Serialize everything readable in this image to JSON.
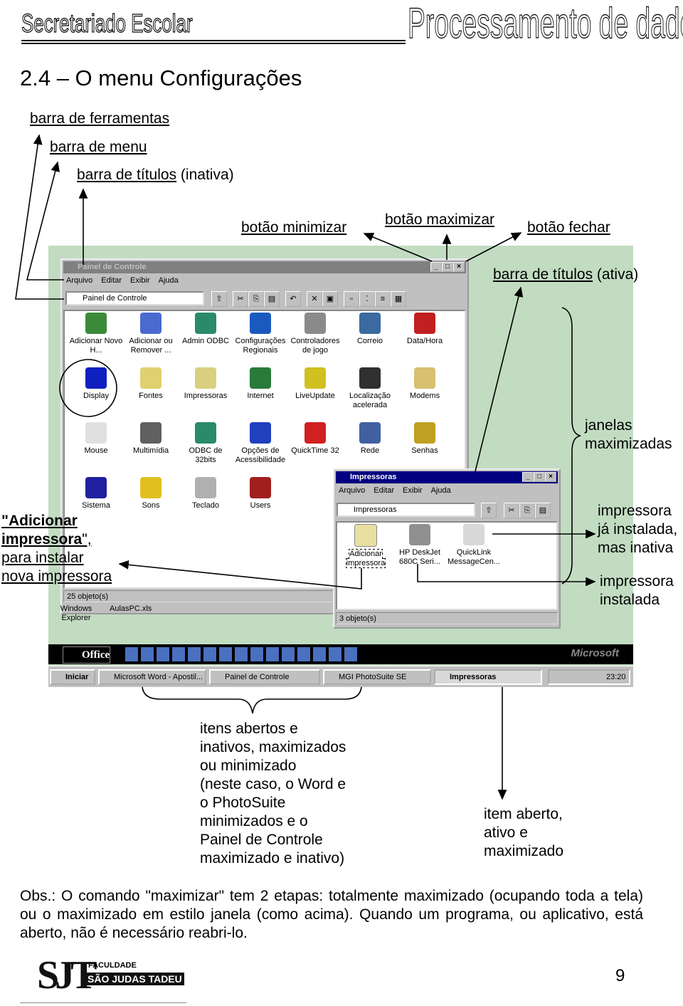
{
  "header": {
    "left": "Secretariado Escolar",
    "right": "Processamento de dados"
  },
  "section_title": "2.4 – O menu Configurações",
  "annotations": {
    "toolbar": "barra de ferramentas",
    "menubar": "barra de menu",
    "title_inactive": "barra de títulos",
    "title_inactive_suffix": " (inativa)",
    "minimize": "botão minimizar",
    "maximize": "botão maximizar",
    "close": "botão fechar",
    "title_active": "barra de títulos",
    "title_active_suffix": " (ativa)",
    "maximized_windows": [
      "janelas",
      "maximizadas"
    ],
    "printer_inactive": [
      "impressora",
      "já instalada,",
      "mas inativa"
    ],
    "printer_installed": [
      "impressora",
      "instalada"
    ],
    "add_printer": {
      "bold": "\"Adicionar",
      "bold2": "impressora",
      "tail2": "\",",
      "line3": "para instalar",
      "line4": "nova impressora"
    },
    "taskbar_items": [
      "itens abertos e",
      "inativos, maximizados",
      "ou minimizado",
      "(neste caso, o Word e",
      "o PhotoSuite",
      "minimizados e o",
      "Painel de Controle",
      "maximizado e inativo)"
    ],
    "active_item": [
      "item aberto,",
      "ativo e",
      "maximizado"
    ]
  },
  "screenshot": {
    "desktop_color": "#c2dcc2",
    "control_panel": {
      "title": "Painel de Controle",
      "menu": [
        "Arquivo",
        "Editar",
        "Exibir",
        "Ajuda"
      ],
      "address": "Painel de Controle",
      "icons": [
        {
          "label": "Adicionar Novo H...",
          "color": "#3a8a3a"
        },
        {
          "label": "Adicionar ou Remover ...",
          "color": "#4a6ad0"
        },
        {
          "label": "Admin ODBC",
          "color": "#2a8a6a"
        },
        {
          "label": "Configurações Regionais",
          "color": "#1a5ac0"
        },
        {
          "label": "Controladores de jogo",
          "color": "#8a8a8a"
        },
        {
          "label": "Correio",
          "color": "#3a6aa0"
        },
        {
          "label": "Data/Hora",
          "color": "#c02020"
        },
        {
          "label": "Display",
          "color": "#1020c0"
        },
        {
          "label": "Fontes",
          "color": "#e0d070"
        },
        {
          "label": "Impressoras",
          "color": "#d8d080"
        },
        {
          "label": "Internet",
          "color": "#2a7a3a"
        },
        {
          "label": "LiveUpdate",
          "color": "#d0c020"
        },
        {
          "label": "Localização acelerada",
          "color": "#303030"
        },
        {
          "label": "Modems",
          "color": "#d8c070"
        },
        {
          "label": "Mouse",
          "color": "#e0e0e0"
        },
        {
          "label": "Multimídia",
          "color": "#606060"
        },
        {
          "label": "ODBC de 32bits",
          "color": "#2a8a6a"
        },
        {
          "label": "Opções de Acessibilidade",
          "color": "#2040c0"
        },
        {
          "label": "QuickTime 32",
          "color": "#d02020"
        },
        {
          "label": "Rede",
          "color": "#4060a0"
        },
        {
          "label": "Senhas",
          "color": "#c0a020"
        },
        {
          "label": "Sistema",
          "color": "#2020a0"
        },
        {
          "label": "Sons",
          "color": "#e0c020"
        },
        {
          "label": "Teclado",
          "color": "#b0b0b0"
        },
        {
          "label": "Users",
          "color": "#a02020"
        }
      ],
      "status": "25 objeto(s)"
    },
    "printers": {
      "title": "Impressoras",
      "menu": [
        "Arquivo",
        "Editar",
        "Exibir",
        "Ajuda"
      ],
      "address": "Impressoras",
      "icons": [
        {
          "label": "Adicionar impressora"
        },
        {
          "label": "HP DeskJet 680C Seri..."
        },
        {
          "label": "QuickLink MessageCen..."
        }
      ],
      "status": "3 objeto(s)"
    },
    "desktop_icons": [
      {
        "label": "Windows Explorer"
      },
      {
        "label": "AulasPC.xls"
      }
    ],
    "office_bar": {
      "label": "Office",
      "brand": "Microsoft"
    },
    "taskbar": {
      "start": "Iniciar",
      "buttons": [
        "Microsoft Word - Apostil...",
        "Painel de Controle",
        "MGI PhotoSuite SE",
        "Impressoras"
      ],
      "clock": "23:20"
    }
  },
  "obs": "Obs.: O comando \"maximizar\" tem 2 etapas: totalmente maximizado (ocupando toda a tela) ou o maximizado em estilo janela (como acima). Quando um programa, ou aplicativo, está aberto, não é necessário reabri-lo.",
  "footer": {
    "logo": "SJT FACULDADE SÃO JUDAS TADEU",
    "page_number": "9"
  }
}
